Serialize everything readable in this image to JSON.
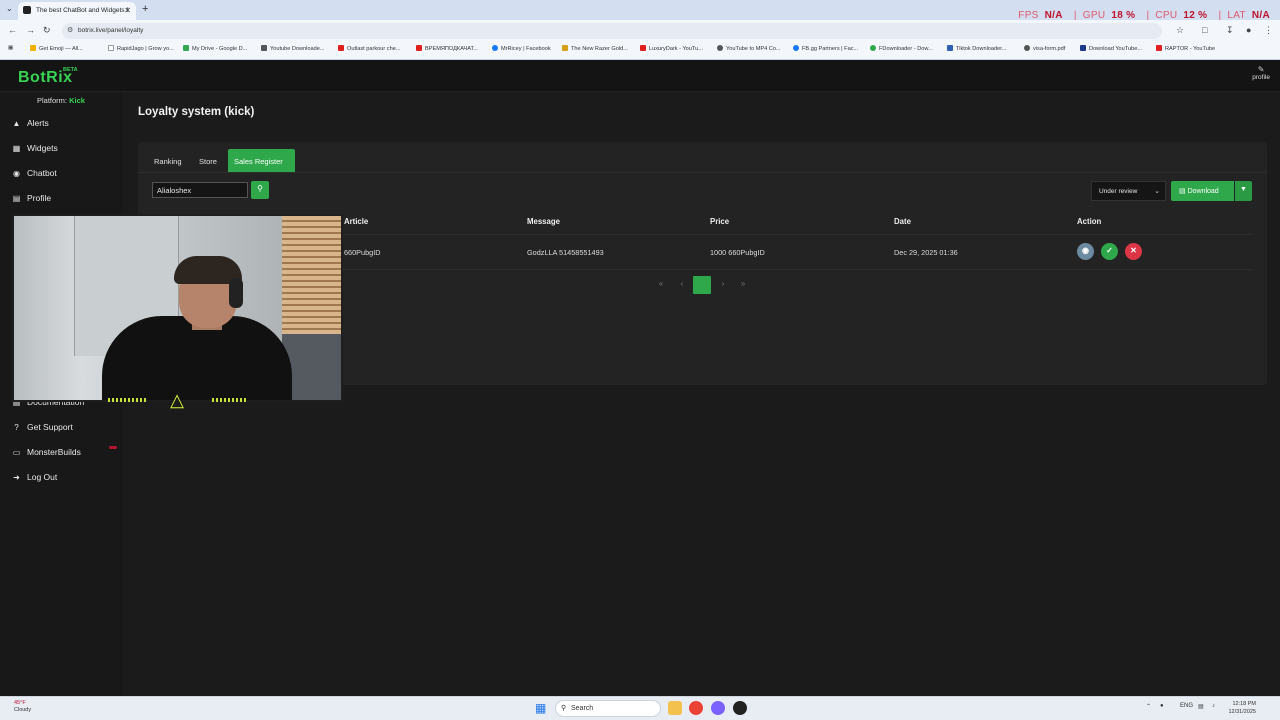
{
  "browser": {
    "tab_title": "The best ChatBot and Widgets f",
    "url": "botrix.live/panel/loyalty",
    "perf": {
      "fps_label": "FPS",
      "fps_value": "N/A",
      "gpu_label": "GPU",
      "gpu_value": "18 %",
      "cpu_label": "CPU",
      "cpu_value": "12 %",
      "lat_label": "LAT",
      "lat_value": "N/A"
    },
    "bookmarks": [
      "Get Emoji — All...",
      "RapidJago | Grow yo...",
      "My Drive - Google D...",
      "Youtube Downloade...",
      "Outlast parkour che...",
      "ВРЕМЯПОДКАЧАТ...",
      "MrRicey | Facebook",
      "The New Razer Gold...",
      "LuxuryDark - YouTu...",
      "YouTube to MP4 Co...",
      "FB.gg Partners | Fac...",
      "FDownloader - Dow...",
      "Tiktok Downloader...",
      "visa-form.pdf",
      "Download YouTube...",
      "RAPTOR - YouTube"
    ]
  },
  "header": {
    "logo": "BotRix",
    "logo_badge": "BETA",
    "profile_label": "profile"
  },
  "sidebar": {
    "platform_label": "Platform:",
    "platform_value": "Kick",
    "items": [
      {
        "label": "Alerts",
        "icon": "warning-icon"
      },
      {
        "label": "Widgets",
        "icon": "grid-icon"
      },
      {
        "label": "Chatbot",
        "icon": "robot-icon"
      },
      {
        "label": "Profile",
        "icon": "id-card-icon"
      },
      {
        "label": "Documentation",
        "icon": "book-icon"
      },
      {
        "label": "Get Support",
        "icon": "help-icon"
      },
      {
        "label": "MonsterBuilds",
        "icon": "laptop-icon"
      },
      {
        "label": "Log Out",
        "icon": "logout-icon"
      }
    ]
  },
  "main": {
    "title": "Loyalty system (kick)",
    "tabs": [
      {
        "label": "Ranking",
        "active": false
      },
      {
        "label": "Store",
        "active": false
      },
      {
        "label": "Sales Register",
        "active": true
      }
    ],
    "search": {
      "value": "Alialoshex"
    },
    "status_filter": {
      "selected": "Under review"
    },
    "download_label": "Download",
    "table": {
      "columns": [
        "Article",
        "Message",
        "Price",
        "Date",
        "Action"
      ],
      "rows": [
        {
          "article": "660PubgID",
          "message": "GodzLLA 51458551493",
          "price": "1000 660PubgID",
          "date": "Dec 29, 2025 01:36"
        }
      ]
    },
    "pagination": {
      "current": 1
    }
  },
  "taskbar": {
    "temp": "45°F",
    "weather": "Cloudy",
    "search_placeholder": "Search",
    "lang": "ENG",
    "time": "12:18 PM",
    "date": "12/31/2025"
  },
  "colors": {
    "accent": "#2ea84a",
    "danger": "#dc3545",
    "view": "#6c8aa0"
  }
}
